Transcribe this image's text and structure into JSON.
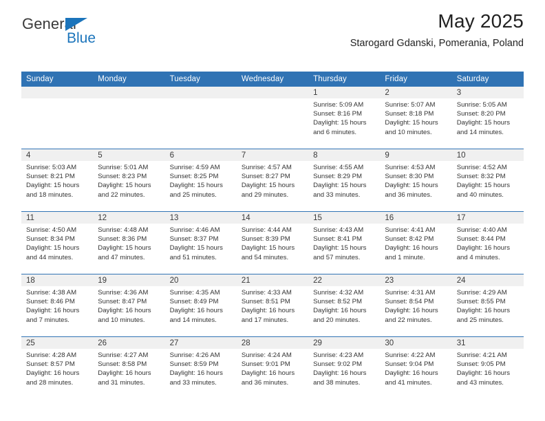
{
  "logo": {
    "word_top": "General",
    "word_bottom": "Blue",
    "triangle_icon": "blue-triangle-icon",
    "brand_blue": "#1b74bb",
    "brand_gray": "#3a3a3a"
  },
  "header": {
    "title": "May 2025",
    "subtitle": "Starogard Gdanski, Pomerania, Poland",
    "accent_color": "#3073b4",
    "daynum_strip_color": "#f0f0f0"
  },
  "calendar": {
    "weekday_headers": [
      "Sunday",
      "Monday",
      "Tuesday",
      "Wednesday",
      "Thursday",
      "Friday",
      "Saturday"
    ],
    "labels": {
      "sunrise": "Sunrise:",
      "sunset": "Sunset:",
      "daylight": "Daylight:"
    },
    "weeks": [
      [
        {
          "day": "",
          "lines": []
        },
        {
          "day": "",
          "lines": []
        },
        {
          "day": "",
          "lines": []
        },
        {
          "day": "",
          "lines": []
        },
        {
          "day": "1",
          "lines": [
            "Sunrise: 5:09 AM",
            "Sunset: 8:16 PM",
            "Daylight: 15 hours",
            "and 6 minutes."
          ]
        },
        {
          "day": "2",
          "lines": [
            "Sunrise: 5:07 AM",
            "Sunset: 8:18 PM",
            "Daylight: 15 hours",
            "and 10 minutes."
          ]
        },
        {
          "day": "3",
          "lines": [
            "Sunrise: 5:05 AM",
            "Sunset: 8:20 PM",
            "Daylight: 15 hours",
            "and 14 minutes."
          ]
        }
      ],
      [
        {
          "day": "4",
          "lines": [
            "Sunrise: 5:03 AM",
            "Sunset: 8:21 PM",
            "Daylight: 15 hours",
            "and 18 minutes."
          ]
        },
        {
          "day": "5",
          "lines": [
            "Sunrise: 5:01 AM",
            "Sunset: 8:23 PM",
            "Daylight: 15 hours",
            "and 22 minutes."
          ]
        },
        {
          "day": "6",
          "lines": [
            "Sunrise: 4:59 AM",
            "Sunset: 8:25 PM",
            "Daylight: 15 hours",
            "and 25 minutes."
          ]
        },
        {
          "day": "7",
          "lines": [
            "Sunrise: 4:57 AM",
            "Sunset: 8:27 PM",
            "Daylight: 15 hours",
            "and 29 minutes."
          ]
        },
        {
          "day": "8",
          "lines": [
            "Sunrise: 4:55 AM",
            "Sunset: 8:29 PM",
            "Daylight: 15 hours",
            "and 33 minutes."
          ]
        },
        {
          "day": "9",
          "lines": [
            "Sunrise: 4:53 AM",
            "Sunset: 8:30 PM",
            "Daylight: 15 hours",
            "and 36 minutes."
          ]
        },
        {
          "day": "10",
          "lines": [
            "Sunrise: 4:52 AM",
            "Sunset: 8:32 PM",
            "Daylight: 15 hours",
            "and 40 minutes."
          ]
        }
      ],
      [
        {
          "day": "11",
          "lines": [
            "Sunrise: 4:50 AM",
            "Sunset: 8:34 PM",
            "Daylight: 15 hours",
            "and 44 minutes."
          ]
        },
        {
          "day": "12",
          "lines": [
            "Sunrise: 4:48 AM",
            "Sunset: 8:36 PM",
            "Daylight: 15 hours",
            "and 47 minutes."
          ]
        },
        {
          "day": "13",
          "lines": [
            "Sunrise: 4:46 AM",
            "Sunset: 8:37 PM",
            "Daylight: 15 hours",
            "and 51 minutes."
          ]
        },
        {
          "day": "14",
          "lines": [
            "Sunrise: 4:44 AM",
            "Sunset: 8:39 PM",
            "Daylight: 15 hours",
            "and 54 minutes."
          ]
        },
        {
          "day": "15",
          "lines": [
            "Sunrise: 4:43 AM",
            "Sunset: 8:41 PM",
            "Daylight: 15 hours",
            "and 57 minutes."
          ]
        },
        {
          "day": "16",
          "lines": [
            "Sunrise: 4:41 AM",
            "Sunset: 8:42 PM",
            "Daylight: 16 hours",
            "and 1 minute."
          ]
        },
        {
          "day": "17",
          "lines": [
            "Sunrise: 4:40 AM",
            "Sunset: 8:44 PM",
            "Daylight: 16 hours",
            "and 4 minutes."
          ]
        }
      ],
      [
        {
          "day": "18",
          "lines": [
            "Sunrise: 4:38 AM",
            "Sunset: 8:46 PM",
            "Daylight: 16 hours",
            "and 7 minutes."
          ]
        },
        {
          "day": "19",
          "lines": [
            "Sunrise: 4:36 AM",
            "Sunset: 8:47 PM",
            "Daylight: 16 hours",
            "and 10 minutes."
          ]
        },
        {
          "day": "20",
          "lines": [
            "Sunrise: 4:35 AM",
            "Sunset: 8:49 PM",
            "Daylight: 16 hours",
            "and 14 minutes."
          ]
        },
        {
          "day": "21",
          "lines": [
            "Sunrise: 4:33 AM",
            "Sunset: 8:51 PM",
            "Daylight: 16 hours",
            "and 17 minutes."
          ]
        },
        {
          "day": "22",
          "lines": [
            "Sunrise: 4:32 AM",
            "Sunset: 8:52 PM",
            "Daylight: 16 hours",
            "and 20 minutes."
          ]
        },
        {
          "day": "23",
          "lines": [
            "Sunrise: 4:31 AM",
            "Sunset: 8:54 PM",
            "Daylight: 16 hours",
            "and 22 minutes."
          ]
        },
        {
          "day": "24",
          "lines": [
            "Sunrise: 4:29 AM",
            "Sunset: 8:55 PM",
            "Daylight: 16 hours",
            "and 25 minutes."
          ]
        }
      ],
      [
        {
          "day": "25",
          "lines": [
            "Sunrise: 4:28 AM",
            "Sunset: 8:57 PM",
            "Daylight: 16 hours",
            "and 28 minutes."
          ]
        },
        {
          "day": "26",
          "lines": [
            "Sunrise: 4:27 AM",
            "Sunset: 8:58 PM",
            "Daylight: 16 hours",
            "and 31 minutes."
          ]
        },
        {
          "day": "27",
          "lines": [
            "Sunrise: 4:26 AM",
            "Sunset: 8:59 PM",
            "Daylight: 16 hours",
            "and 33 minutes."
          ]
        },
        {
          "day": "28",
          "lines": [
            "Sunrise: 4:24 AM",
            "Sunset: 9:01 PM",
            "Daylight: 16 hours",
            "and 36 minutes."
          ]
        },
        {
          "day": "29",
          "lines": [
            "Sunrise: 4:23 AM",
            "Sunset: 9:02 PM",
            "Daylight: 16 hours",
            "and 38 minutes."
          ]
        },
        {
          "day": "30",
          "lines": [
            "Sunrise: 4:22 AM",
            "Sunset: 9:04 PM",
            "Daylight: 16 hours",
            "and 41 minutes."
          ]
        },
        {
          "day": "31",
          "lines": [
            "Sunrise: 4:21 AM",
            "Sunset: 9:05 PM",
            "Daylight: 16 hours",
            "and 43 minutes."
          ]
        }
      ]
    ]
  }
}
